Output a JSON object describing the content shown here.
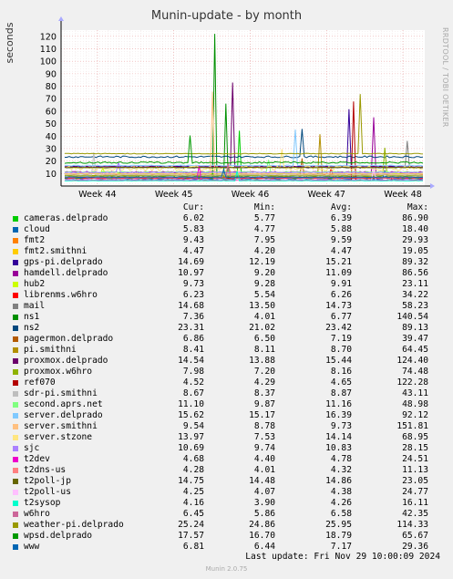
{
  "title": "Munin-update - by month",
  "vertical_label": "seconds",
  "side_text": "RRDTOOL / TOBI OETIKER",
  "legend_headers": {
    "cur": "Cur:",
    "min": "Min:",
    "avg": "Avg:",
    "max": "Max:"
  },
  "last_update": "Last update: Fri Nov 29 10:00:09 2024",
  "footer": "Munin 2.0.75",
  "chart_data": {
    "type": "line",
    "title": "Munin-update - by month",
    "ylabel": "seconds",
    "xlabel": "",
    "x_ticks": [
      "Week 44",
      "Week 45",
      "Week 46",
      "Week 47",
      "Week 48"
    ],
    "y_ticks": [
      10,
      20,
      30,
      40,
      50,
      60,
      70,
      80,
      90,
      100,
      110,
      120
    ],
    "ylim": [
      0,
      125
    ],
    "grid": true,
    "legend_placement": "below",
    "series": [
      {
        "name": "cameras.delprado",
        "color": "#00cc00",
        "cur": "6.02",
        "min": "5.77",
        "avg": "6.39",
        "max": "86.90"
      },
      {
        "name": "cloud",
        "color": "#0066b3",
        "cur": "5.83",
        "min": "4.77",
        "avg": "5.88",
        "max": "18.40"
      },
      {
        "name": "fmt2",
        "color": "#ff8000",
        "cur": "9.43",
        "min": "7.95",
        "avg": "9.59",
        "max": "29.93"
      },
      {
        "name": "fmt2.smithni",
        "color": "#ffcc00",
        "cur": "4.47",
        "min": "4.20",
        "avg": "4.47",
        "max": "19.05"
      },
      {
        "name": "gps-pi.delprado",
        "color": "#330099",
        "cur": "14.69",
        "min": "12.19",
        "avg": "15.21",
        "max": "89.32"
      },
      {
        "name": "hamdell.delprado",
        "color": "#990099",
        "cur": "10.97",
        "min": "9.20",
        "avg": "11.09",
        "max": "86.56"
      },
      {
        "name": "hub2",
        "color": "#ccff00",
        "cur": "9.73",
        "min": "9.28",
        "avg": "9.91",
        "max": "23.11"
      },
      {
        "name": "librenms.w6hro",
        "color": "#ff0000",
        "cur": "6.23",
        "min": "5.54",
        "avg": "6.26",
        "max": "34.22"
      },
      {
        "name": "mail",
        "color": "#808080",
        "cur": "14.68",
        "min": "13.50",
        "avg": "14.73",
        "max": "58.23"
      },
      {
        "name": "ns1",
        "color": "#008f00",
        "cur": "7.36",
        "min": "4.01",
        "avg": "6.77",
        "max": "140.54"
      },
      {
        "name": "ns2",
        "color": "#00487d",
        "cur": "23.31",
        "min": "21.02",
        "avg": "23.42",
        "max": "89.13"
      },
      {
        "name": "pagermon.delprado",
        "color": "#b35a00",
        "cur": "6.86",
        "min": "6.50",
        "avg": "7.19",
        "max": "39.47"
      },
      {
        "name": "pi.smithni",
        "color": "#b38f00",
        "cur": "8.41",
        "min": "8.11",
        "avg": "8.70",
        "max": "64.45"
      },
      {
        "name": "proxmox.delprado",
        "color": "#6b006b",
        "cur": "14.54",
        "min": "13.88",
        "avg": "15.44",
        "max": "124.40"
      },
      {
        "name": "proxmox.w6hro",
        "color": "#8fb300",
        "cur": "7.98",
        "min": "7.20",
        "avg": "8.16",
        "max": "74.48"
      },
      {
        "name": "ref070",
        "color": "#b30000",
        "cur": "4.52",
        "min": "4.29",
        "avg": "4.65",
        "max": "122.28"
      },
      {
        "name": "sdr-pi.smithni",
        "color": "#bebebe",
        "cur": "8.67",
        "min": "8.37",
        "avg": "8.87",
        "max": "43.11"
      },
      {
        "name": "second.aprs.net",
        "color": "#80ff80",
        "cur": "11.10",
        "min": "9.87",
        "avg": "11.16",
        "max": "48.98"
      },
      {
        "name": "server.delprado",
        "color": "#80c9ff",
        "cur": "15.62",
        "min": "15.17",
        "avg": "16.39",
        "max": "92.12"
      },
      {
        "name": "server.smithni",
        "color": "#ffc080",
        "cur": "9.54",
        "min": "8.78",
        "avg": "9.73",
        "max": "151.81"
      },
      {
        "name": "server.stzone",
        "color": "#ffe680",
        "cur": "13.97",
        "min": "7.53",
        "avg": "14.14",
        "max": "68.95"
      },
      {
        "name": "sjc",
        "color": "#aa80ff",
        "cur": "10.69",
        "min": "9.74",
        "avg": "10.83",
        "max": "28.15"
      },
      {
        "name": "t2dev",
        "color": "#ee00cc",
        "cur": "4.68",
        "min": "4.40",
        "avg": "4.78",
        "max": "24.51"
      },
      {
        "name": "t2dns-us",
        "color": "#ff8080",
        "cur": "4.28",
        "min": "4.01",
        "avg": "4.32",
        "max": "11.13"
      },
      {
        "name": "t2poll-jp",
        "color": "#666600",
        "cur": "14.75",
        "min": "14.48",
        "avg": "14.86",
        "max": "23.05"
      },
      {
        "name": "t2poll-us",
        "color": "#ffbfff",
        "cur": "4.25",
        "min": "4.07",
        "avg": "4.38",
        "max": "24.77"
      },
      {
        "name": "t2sysop",
        "color": "#00ffcc",
        "cur": "4.16",
        "min": "3.90",
        "avg": "4.26",
        "max": "16.11"
      },
      {
        "name": "w6hro",
        "color": "#cc6699",
        "cur": "6.45",
        "min": "5.86",
        "avg": "6.58",
        "max": "42.35"
      },
      {
        "name": "weather-pi.delprado",
        "color": "#999900",
        "cur": "25.24",
        "min": "24.86",
        "avg": "25.95",
        "max": "114.33"
      },
      {
        "name": "wpsd.delprado",
        "color": "#009900",
        "cur": "17.57",
        "min": "16.70",
        "avg": "18.79",
        "max": "65.67"
      },
      {
        "name": "www",
        "color": "#0066b3",
        "cur": "6.81",
        "min": "6.44",
        "avg": "7.17",
        "max": "29.36"
      }
    ]
  }
}
